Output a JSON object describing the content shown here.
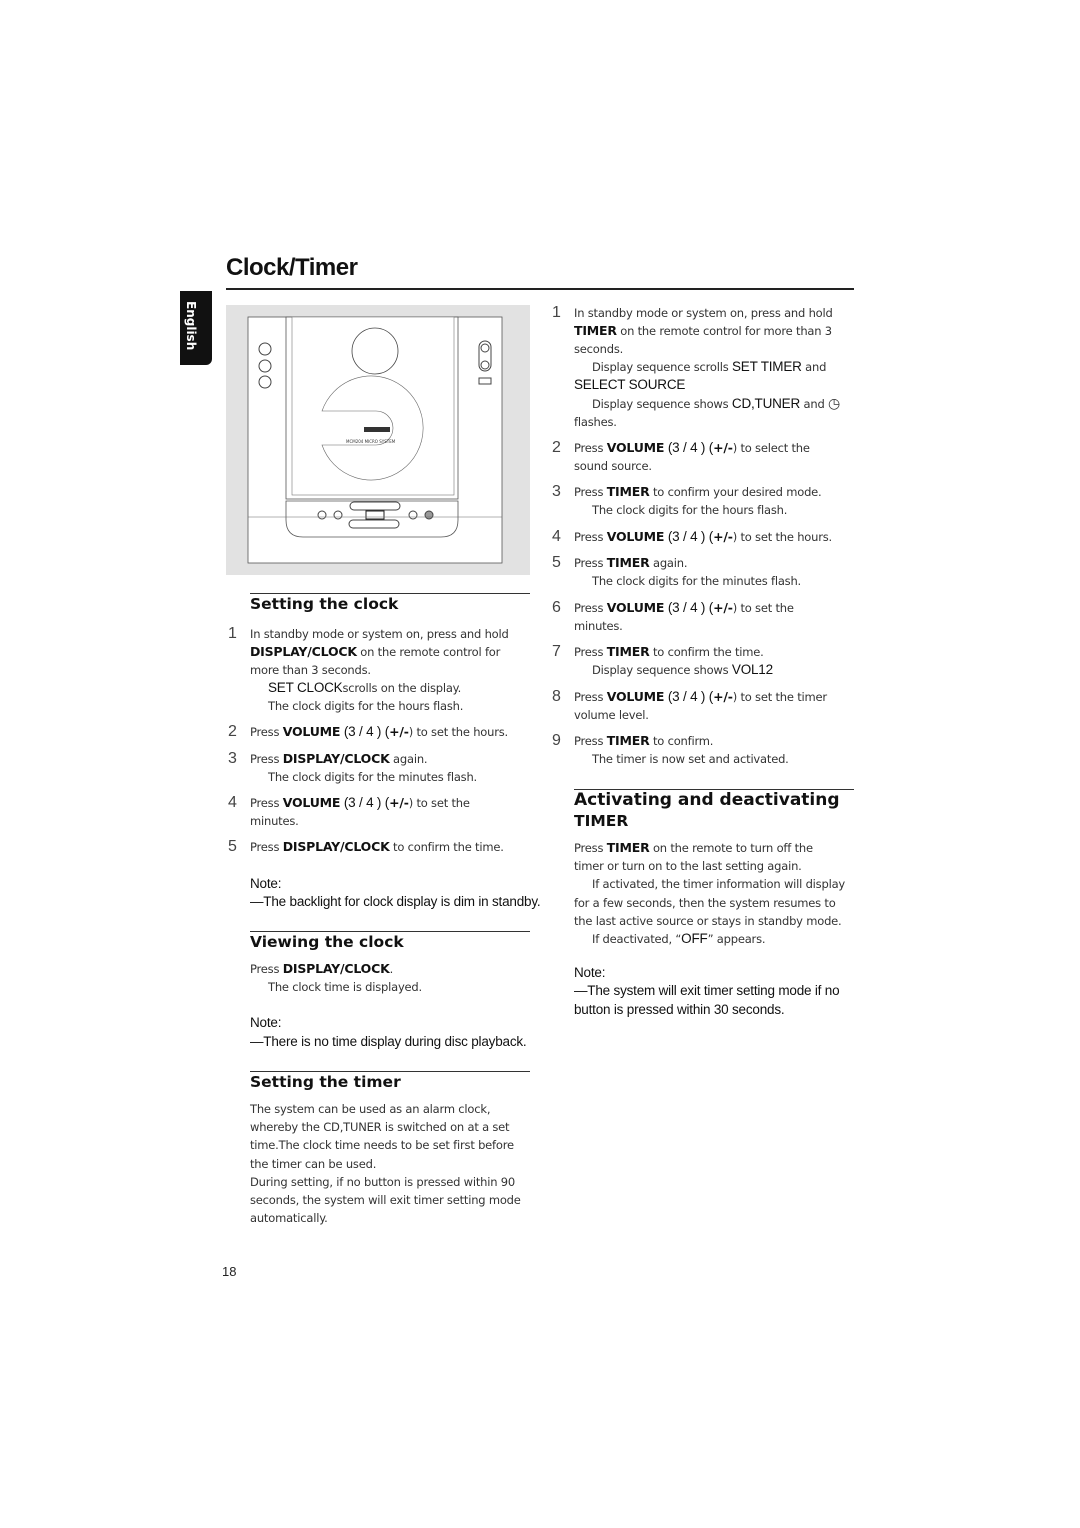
{
  "page": {
    "title": "Clock/Timer",
    "language_tab": "English",
    "page_number": "18"
  },
  "device_image": {
    "brand_logo": "PHILIPS",
    "model": "MCM204 MICRO SYSTEM"
  },
  "left": {
    "setting_clock": {
      "heading": "Setting the clock",
      "lines": [
        {
          "n": "1",
          "s": [
            [
              "In standby mode or system on, press and hold"
            ]
          ]
        },
        {
          "s": [
            [
              "DISPLAY/CLOCK",
              "b"
            ],
            [
              " on the remote control for"
            ]
          ]
        },
        {
          "s": [
            [
              "more than 3 seconds."
            ]
          ]
        },
        {
          "i": 1,
          "s": [
            [
              "SET CLOCK",
              "d"
            ],
            [
              "scrolls on the display."
            ]
          ]
        },
        {
          "i": 1,
          "s": [
            [
              "The clock digits for the hours flash."
            ]
          ]
        },
        {
          "n": "2",
          "s": [
            [
              "Press "
            ],
            [
              "VOLUME",
              "b"
            ],
            [
              " (3  / 4 ) (",
              "d"
            ],
            [
              "+/-",
              "b"
            ],
            [
              ") to set the hours."
            ]
          ]
        },
        {
          "n": "3",
          "s": [
            [
              "Press "
            ],
            [
              "DISPLAY/CLOCK",
              "b"
            ],
            [
              " again."
            ]
          ]
        },
        {
          "i": 1,
          "s": [
            [
              "The clock digits for the minutes flash."
            ]
          ]
        },
        {
          "n": "4",
          "s": [
            [
              "Press "
            ],
            [
              "VOLUME",
              "b"
            ],
            [
              " (3  / 4 ) (",
              "d"
            ],
            [
              "+/-",
              "b"
            ],
            [
              ") to set the"
            ]
          ]
        },
        {
          "s": [
            [
              "minutes."
            ]
          ]
        },
        {
          "n": "5",
          "s": [
            [
              "Press "
            ],
            [
              "DISPLAY/CLOCK",
              "b"
            ],
            [
              " to confirm the time."
            ]
          ]
        },
        {
          "note": 1,
          "s": [
            [
              "Note:"
            ]
          ]
        },
        {
          "note": 1,
          "o": 1,
          "s": [
            [
              "—The backlight for clock display is dim in standby."
            ]
          ]
        }
      ]
    },
    "viewing_clock": {
      "heading": "Viewing the clock",
      "lines": [
        {
          "s": [
            [
              "Press "
            ],
            [
              "DISPLAY/CLOCK",
              "b"
            ],
            [
              "."
            ]
          ]
        },
        {
          "i": 1,
          "s": [
            [
              "The clock time is displayed."
            ]
          ]
        },
        {
          "note": 1,
          "s": [
            [
              "Note:"
            ]
          ]
        },
        {
          "note": 1,
          "s": [
            [
              "—There is no time display during disc playback."
            ]
          ]
        }
      ]
    },
    "setting_timer": {
      "heading": "Setting the timer",
      "lines": [
        {
          "s": [
            [
              "The system can be used as an alarm clock,"
            ]
          ]
        },
        {
          "s": [
            [
              "whereby the CD,TUNER is switched on at a set"
            ]
          ]
        },
        {
          "s": [
            [
              "time.The clock time needs to be set first before"
            ]
          ]
        },
        {
          "s": [
            [
              "the timer can be used."
            ]
          ]
        },
        {
          "s": [
            [
              "During setting, if no button is pressed within 90"
            ]
          ]
        },
        {
          "s": [
            [
              "seconds, the system will exit timer setting mode"
            ]
          ]
        },
        {
          "s": [
            [
              "automatically."
            ]
          ]
        }
      ]
    }
  },
  "right": {
    "timer_steps": {
      "lines": [
        {
          "n": "1",
          "s": [
            [
              "In standby mode or system on, press and hold"
            ]
          ]
        },
        {
          "s": [
            [
              "TIMER",
              "b"
            ],
            [
              " on the remote control for more than 3"
            ]
          ]
        },
        {
          "s": [
            [
              "seconds."
            ]
          ]
        },
        {
          "i": 1,
          "s": [
            [
              "Display sequence scrolls "
            ],
            [
              "SET TIMER",
              "d"
            ],
            [
              " and"
            ]
          ]
        },
        {
          "s": [
            [
              "SELECT SOURCE",
              "d"
            ]
          ]
        },
        {
          "i": 1,
          "s": [
            [
              "Display sequence shows "
            ],
            [
              "CD,TUNER",
              "d"
            ],
            [
              " and "
            ],
            [
              "◷",
              "ic"
            ]
          ]
        },
        {
          "s": [
            [
              "flashes."
            ]
          ]
        },
        {
          "n": "2",
          "s": [
            [
              "Press "
            ],
            [
              "VOLUME",
              "b"
            ],
            [
              " (3  / 4 ) (",
              "d"
            ],
            [
              "+/-",
              "b"
            ],
            [
              ") to select the"
            ]
          ]
        },
        {
          "s": [
            [
              "sound source."
            ]
          ]
        },
        {
          "n": "3",
          "s": [
            [
              "Press "
            ],
            [
              "TIMER",
              "b"
            ],
            [
              " to confirm your desired mode."
            ]
          ]
        },
        {
          "i": 1,
          "s": [
            [
              "The clock digits for the hours flash."
            ]
          ]
        },
        {
          "n": "4",
          "s": [
            [
              "Press "
            ],
            [
              "VOLUME",
              "b"
            ],
            [
              " (3  / 4 ) (",
              "d"
            ],
            [
              "+/-",
              "b"
            ],
            [
              ") to set the hours."
            ]
          ]
        },
        {
          "n": "5",
          "s": [
            [
              "Press "
            ],
            [
              "TIMER",
              "b"
            ],
            [
              " again."
            ]
          ]
        },
        {
          "i": 1,
          "s": [
            [
              "The clock digits for the minutes flash."
            ]
          ]
        },
        {
          "n": "6",
          "s": [
            [
              "Press "
            ],
            [
              "VOLUME",
              "b"
            ],
            [
              " (3  / 4 ) (",
              "d"
            ],
            [
              "+/-",
              "b"
            ],
            [
              ") to set the"
            ]
          ]
        },
        {
          "s": [
            [
              "minutes."
            ]
          ]
        },
        {
          "n": "7",
          "s": [
            [
              "Press "
            ],
            [
              "TIMER",
              "b"
            ],
            [
              " to confirm the time."
            ]
          ]
        },
        {
          "i": 1,
          "s": [
            [
              "Display sequence shows "
            ],
            [
              "VOL12",
              "d"
            ]
          ]
        },
        {
          "n": "8",
          "s": [
            [
              "Press "
            ],
            [
              "VOLUME",
              "b"
            ],
            [
              " (3  / 4 ) (",
              "d"
            ],
            [
              "+/-",
              "b"
            ],
            [
              ") to set the timer"
            ]
          ]
        },
        {
          "s": [
            [
              "volume level."
            ]
          ]
        },
        {
          "n": "9",
          "s": [
            [
              "Press "
            ],
            [
              "TIMER",
              "b"
            ],
            [
              " to confirm."
            ]
          ]
        },
        {
          "i": 1,
          "s": [
            [
              "The timer is now set and activated."
            ]
          ]
        }
      ]
    },
    "activating": {
      "heading_line1": "Activating and deactivating",
      "heading_line2": "TIMER",
      "lines": [
        {
          "s": [
            [
              "Press "
            ],
            [
              "TIMER",
              "b"
            ],
            [
              " on the remote to turn off the"
            ]
          ]
        },
        {
          "s": [
            [
              "timer or turn on to the last setting again."
            ]
          ]
        },
        {
          "i": 1,
          "s": [
            [
              "If activated, the timer information will display"
            ]
          ]
        },
        {
          "s": [
            [
              "for a few seconds, then the system resumes to"
            ]
          ]
        },
        {
          "s": [
            [
              "the last active source or stays in standby mode."
            ]
          ]
        },
        {
          "i": 1,
          "s": [
            [
              "If deactivated, “"
            ],
            [
              "OFF",
              "d"
            ],
            [
              "” appears."
            ]
          ]
        },
        {
          "note": 1,
          "s": [
            [
              "Note:"
            ]
          ]
        },
        {
          "note": 1,
          "s": [
            [
              "—The system will exit timer setting mode if no"
            ]
          ]
        },
        {
          "note": 1,
          "s": [
            [
              "button is pressed within 30 seconds."
            ]
          ]
        }
      ]
    }
  }
}
